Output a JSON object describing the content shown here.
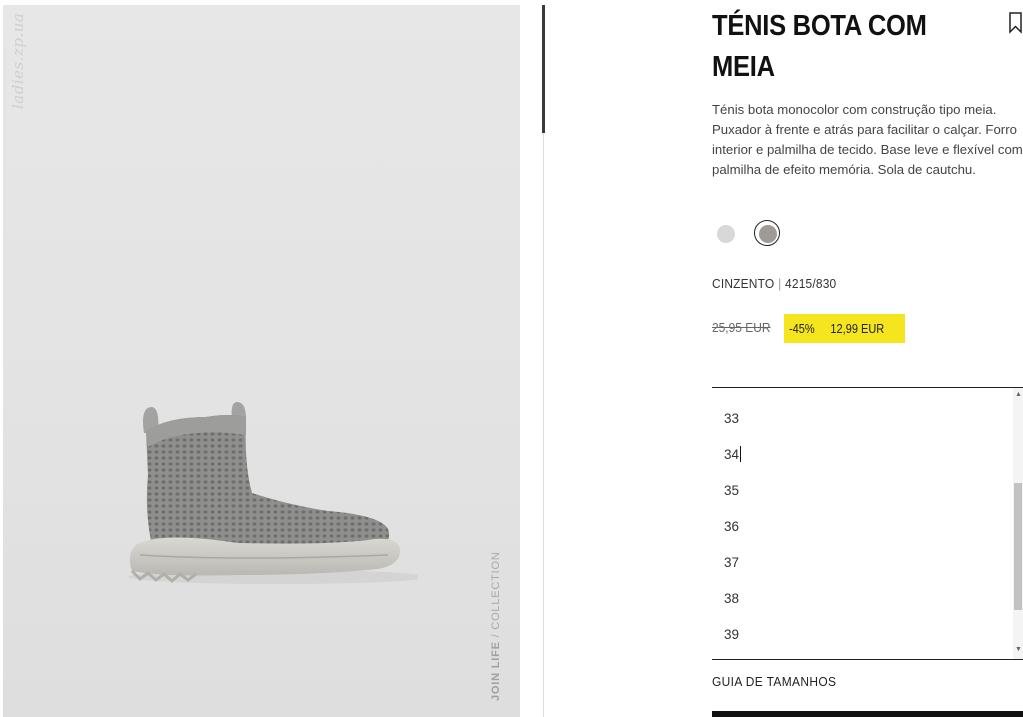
{
  "image": {
    "watermark": "ladies.zp.ua",
    "tag_prefix": "JOIN LIFE",
    "tag_suffix": " / COLLECTION"
  },
  "product": {
    "title": "TÉNIS BOTA COM MEIA",
    "description": "Ténis bota monocolor com construção tipo meia. Puxador à frente e atrás para facilitar o calçar. Forro interior e palmilha de tecido. Base leve e flexível com palmilha de efeito memória. Sola de cautchu.",
    "colors": [
      {
        "name": "light-grey",
        "hex": "#d8d8d8",
        "selected": false
      },
      {
        "name": "grey",
        "hex": "#9d9a97",
        "selected": true
      }
    ],
    "color_name": "CINZENTO",
    "separator": "|",
    "reference": "4215/830",
    "old_price": "25,95 EUR",
    "discount": "-45%",
    "new_price": "12,99 EUR",
    "sale_color": "#f5e51e"
  },
  "sizes": [
    "33",
    "34",
    "35",
    "36",
    "37",
    "38",
    "39"
  ],
  "size_guide_label": "GUIA DE TAMANHOS"
}
